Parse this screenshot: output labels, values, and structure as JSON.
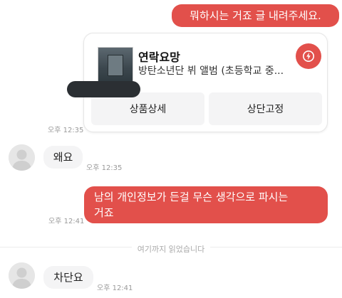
{
  "messages": {
    "m1": {
      "text": "뭐하시는 거죠 글 내려주세요."
    },
    "product_card": {
      "title": "연락요망",
      "subtitle": "방탄소년단 뷔 앨범 (초등학교 중...",
      "buttons": [
        "상품상세",
        "상단고정"
      ],
      "time": "오후 12:35"
    },
    "m2": {
      "text": "왜요",
      "time": "오후 12:35"
    },
    "m3": {
      "line1": "남의 개인정보가 든걸 무슨 생각으로 파시는",
      "line2": "거죠",
      "time": "오후 12:41"
    },
    "read_marker": "여기까지 읽었습니다",
    "m4": {
      "text": "차단요",
      "time": "오후 12:41"
    }
  },
  "colors": {
    "accent": "#e2504b",
    "incoming_bubble": "#f4f4f5"
  },
  "icons": {
    "card_badge": "flash-icon",
    "avatar": "user-avatar-icon"
  }
}
